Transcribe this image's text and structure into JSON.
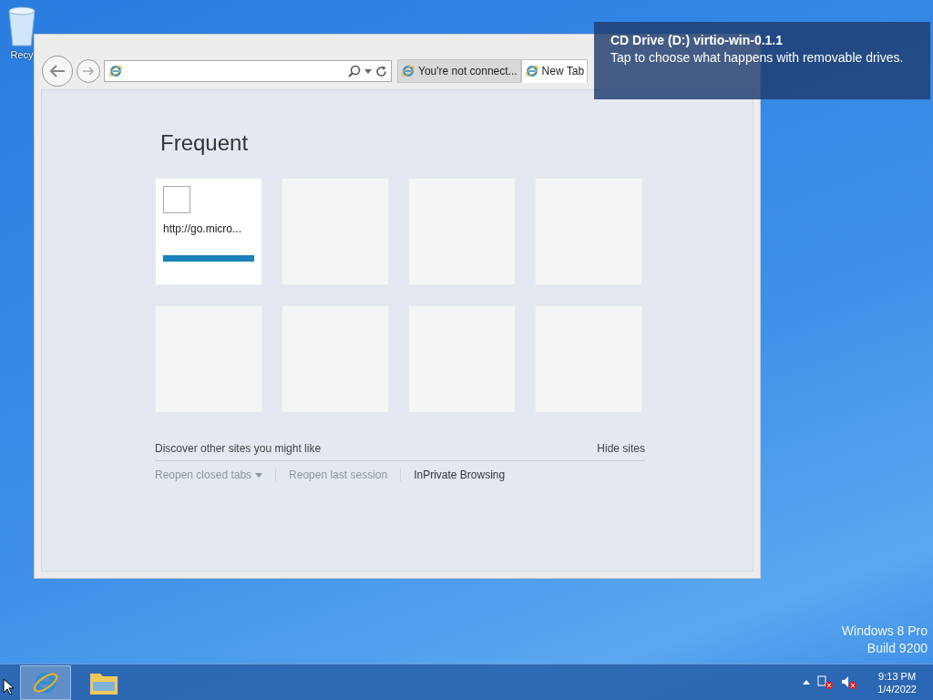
{
  "desktop": {
    "icons": [
      {
        "label": "Recy"
      }
    ],
    "watermark": [
      "Windows 8 Pro",
      "Build 9200"
    ]
  },
  "browser": {
    "tabs": [
      {
        "label": "You're not connect...",
        "selected": false
      },
      {
        "label": "New Tab",
        "selected": true
      }
    ],
    "new_tab_page": {
      "heading": "Frequent",
      "tiles": [
        {
          "kind": "site",
          "label": "http://go.micro..."
        },
        {
          "kind": "empty"
        },
        {
          "kind": "empty"
        },
        {
          "kind": "empty"
        },
        {
          "kind": "empty"
        },
        {
          "kind": "empty"
        },
        {
          "kind": "empty"
        },
        {
          "kind": "empty"
        }
      ],
      "discover": "Discover other sites you might like",
      "hide_sites": "Hide sites",
      "links": [
        {
          "label": "Reopen closed tabs",
          "disabled": true,
          "dropdown": true
        },
        {
          "label": "Reopen last session",
          "disabled": true,
          "dropdown": false
        },
        {
          "label": "InPrivate Browsing",
          "disabled": false,
          "dropdown": false
        }
      ]
    }
  },
  "notification": {
    "title": "CD Drive (D:) virtio-win-0.1.1",
    "message": "Tap to choose what happens with removable drives."
  },
  "taskbar": {
    "apps": [
      {
        "kind": "ie",
        "selected": true
      },
      {
        "kind": "explorer",
        "selected": false
      }
    ],
    "time": "9:13 PM",
    "date": "1/4/2022"
  }
}
